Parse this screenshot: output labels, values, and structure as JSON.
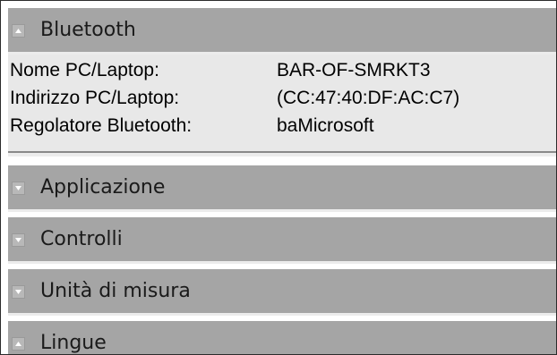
{
  "sections": {
    "bluetooth": {
      "title": "Bluetooth",
      "state": "expanded"
    },
    "applicazione": {
      "title": "Applicazione",
      "state": "collapsed"
    },
    "controlli": {
      "title": "Controlli",
      "state": "collapsed"
    },
    "unita": {
      "title": "Unità di misura",
      "state": "collapsed"
    },
    "lingue": {
      "title": "Lingue",
      "state": "expanded"
    }
  },
  "bluetooth_details": {
    "pc_name_label": "Nome PC/Laptop:",
    "pc_name_value": "BAR-OF-SMRKT3",
    "pc_address_label": "Indirizzo PC/Laptop:",
    "pc_address_value": "(CC:47:40:DF:AC:C7)",
    "controller_label": "Regolatore Bluetooth:",
    "controller_value": "baMicrosoft"
  },
  "colors": {
    "header_bg": "#a5a5a5",
    "panel_bg": "#e8e8e8",
    "separator": "#ededed"
  },
  "icons": {
    "expanded": "caret-up-icon",
    "collapsed": "caret-down-icon"
  }
}
